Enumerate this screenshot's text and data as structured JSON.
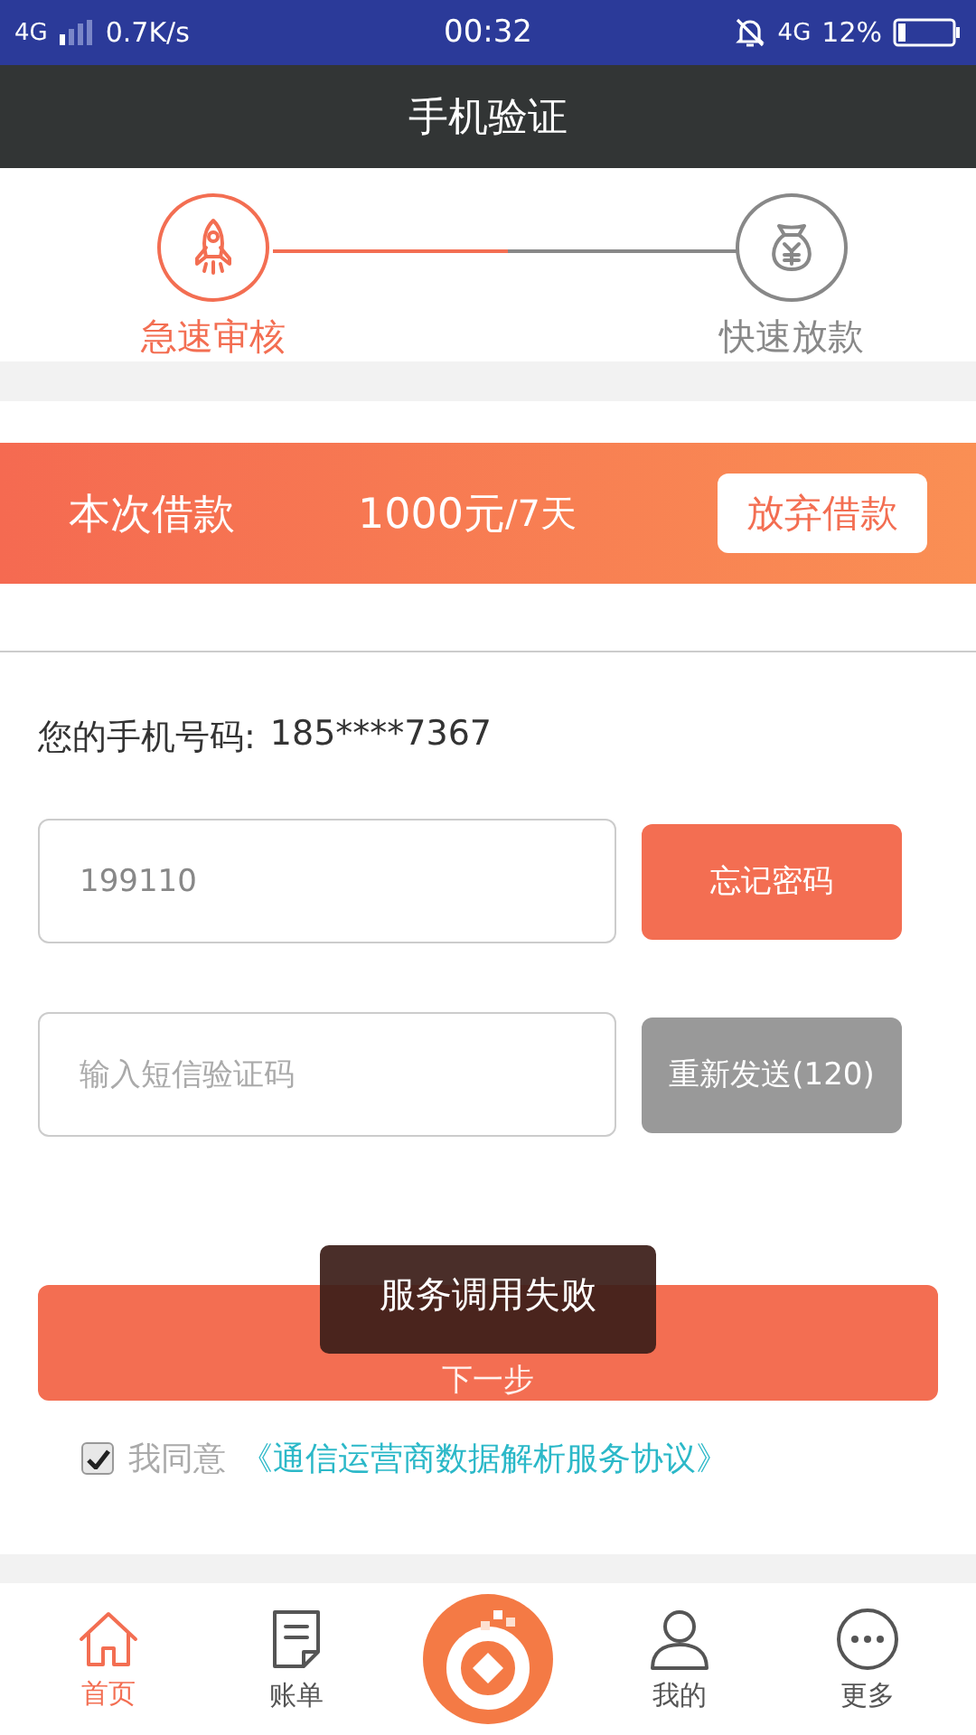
{
  "status_bar": {
    "network": "4G",
    "speed": "0.7K/s",
    "time": "00:32",
    "data_type": "4G",
    "battery": "12%"
  },
  "header": {
    "title": "手机验证"
  },
  "steps": {
    "progress": {
      "level": 0.5
    },
    "items": [
      {
        "label": "急速审核",
        "active": true
      },
      {
        "label": "快速放款",
        "active": false
      }
    ]
  },
  "loan": {
    "label": "本次借款",
    "amount": "1000元",
    "term": "/7天",
    "button": "放弃借款"
  },
  "phone": {
    "label": "您的手机号码:",
    "number": "185****7367"
  },
  "fields": [
    {
      "value": "199110",
      "button": "忘记密码",
      "button_disabled": false
    },
    {
      "placeholder": "输入短信验证码",
      "button": "重新发送(120)",
      "button_disabled": true
    }
  ],
  "next_button": "下一步",
  "toast": "服务调用失败",
  "agreement": {
    "checked": true,
    "label": "我同意",
    "link": "《通信运营商数据解析服务协议》"
  },
  "tab_bar": [
    {
      "kind": "tab",
      "label": "首页",
      "selected": true
    },
    {
      "kind": "tab",
      "label": "账单",
      "selected": false
    },
    {
      "kind": "logo"
    },
    {
      "kind": "tab",
      "label": "我的",
      "selected": false
    },
    {
      "kind": "tab",
      "label": "更多",
      "selected": false
    }
  ]
}
